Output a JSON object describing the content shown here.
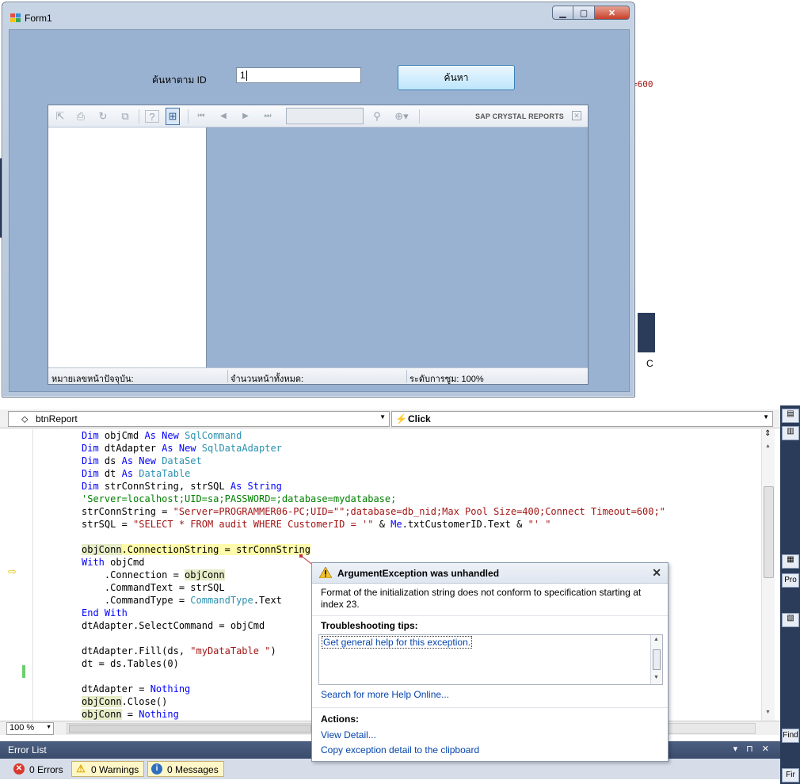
{
  "form": {
    "title": "Form1",
    "search_label": "ค้นหาตาม ID",
    "search_value": "1",
    "search_button": "ค้นหา",
    "viewer": {
      "brand": "SAP CRYSTAL REPORTS",
      "status_current_page": "หมายเลขหน้าปัจจุบัน:",
      "status_total_pages": "จำนวนหน้าทั้งหมด:",
      "status_zoom": "ระดับการซูม: 100%"
    }
  },
  "background": {
    "red_text": "=600",
    "c_text": "C"
  },
  "editor": {
    "nav_left": "btnReport",
    "nav_right": "Click",
    "zoom": "100 %",
    "code_lines": [
      "Dim objCmd As New SqlCommand",
      "Dim dtAdapter As New SqlDataAdapter",
      "Dim ds As New DataSet",
      "Dim dt As DataTable",
      "Dim strConnString, strSQL As String",
      "'Server=localhost;UID=sa;PASSWORD=;database=mydatabase;",
      "strConnString = \"Server=PROGRAMMER06-PC;UID=\"\";database=db_nid;Max Pool Size=400;Connect Timeout=600;\"",
      "strSQL = \"SELECT * FROM audit WHERE CustomerID = '\" & Me.txtCustomerID.Text & \"' \"",
      "",
      "objConn.ConnectionString = strConnString",
      "With objCmd",
      "    .Connection = objConn",
      "    .CommandText = strSQL",
      "    .CommandType = CommandType.Text",
      "End With",
      "dtAdapter.SelectCommand = objCmd",
      "",
      "dtAdapter.Fill(ds, \"myDataTable \")",
      "dt = ds.Tables(0)",
      "",
      "dtAdapter = Nothing",
      "objConn.Close()",
      "objConn = Nothing"
    ]
  },
  "exception": {
    "title": "ArgumentException was unhandled",
    "message": "Format of the initialization string does not conform to specification starting at index 23.",
    "tips_heading": "Troubleshooting tips:",
    "tip_link": "Get general help for this exception.",
    "search_online": "Search for more Help Online...",
    "actions_heading": "Actions:",
    "view_detail": "View Detail...",
    "copy_detail": "Copy exception detail to the clipboard"
  },
  "error_list": {
    "title": "Error List",
    "errors": "0 Errors",
    "warnings": "0 Warnings",
    "messages": "0 Messages"
  },
  "right_dock": {
    "label1": "Pro",
    "label2": "Find",
    "label3": "Fir"
  },
  "colors": {
    "form_client": "#9ab2d1",
    "keyword": "#0000ff",
    "type": "#2b91af",
    "string": "#a31515",
    "comment": "#008000",
    "link": "#0645ad"
  }
}
